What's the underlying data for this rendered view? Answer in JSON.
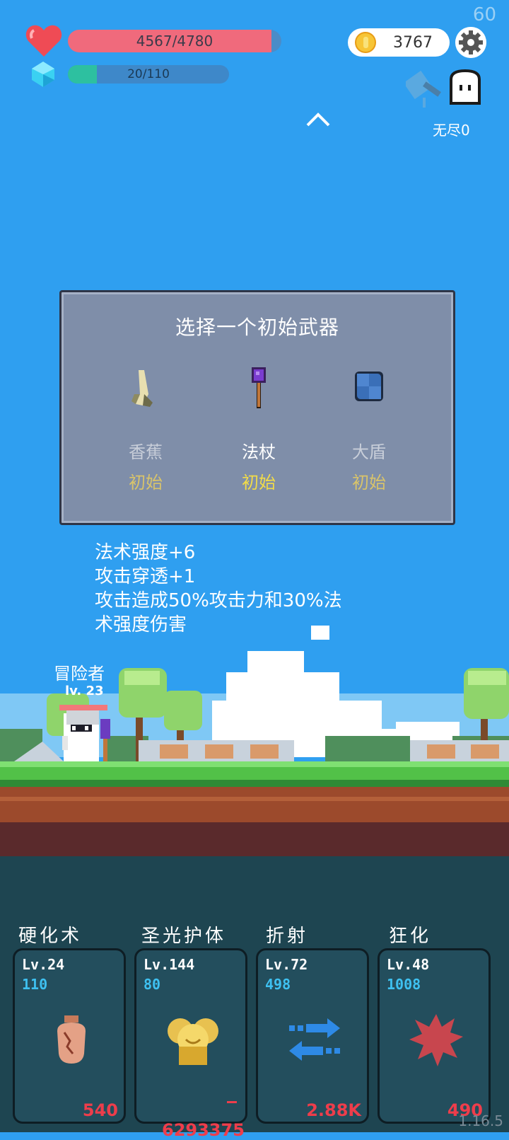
{
  "hud": {
    "fps": "60",
    "hp_text": "4567/4780",
    "hp_fraction": 0.955,
    "mp_text": "20/110",
    "mp_fraction": 0.18,
    "coins": "3767",
    "endless": "无尽0",
    "version": "1.16.5"
  },
  "weapon_panel": {
    "title": "选择一个初始武器",
    "weapons": [
      {
        "name": "香蕉",
        "tier": "初始",
        "icon": "banana-icon"
      },
      {
        "name": "法杖",
        "tier": "初始",
        "icon": "staff-icon"
      },
      {
        "name": "大盾",
        "tier": "初始",
        "icon": "shield-icon"
      }
    ],
    "selected_index": 1
  },
  "description": [
    "法术强度+6",
    "攻击穿透+1",
    "攻击造成50%攻击力和30%法",
    "术强度伤害"
  ],
  "hero": {
    "name": "冒险者",
    "level": "lv. 23"
  },
  "skills": [
    {
      "title": "硬化术",
      "level": "Lv.24",
      "value": "110",
      "cost": "540",
      "icon": "cracked-vase-icon"
    },
    {
      "title": "圣光护体",
      "level": "Lv.144",
      "value": "80",
      "cost": "6293375",
      "icon": "golden-shield-icon"
    },
    {
      "title": "折射",
      "level": "Lv.72",
      "value": "498",
      "cost": "2.88K",
      "icon": "swap-arrows-icon"
    },
    {
      "title": "狂化",
      "level": "Lv.48",
      "value": "1008",
      "cost": "490",
      "icon": "rage-splat-icon"
    }
  ],
  "colors": {
    "sky": "#2f9ff0",
    "hp": "#f06a7c",
    "mp": "#2dc0a0",
    "cost": "#ee3d4b",
    "skill_value": "#3ec0f0",
    "tier": "#f2dc48"
  }
}
